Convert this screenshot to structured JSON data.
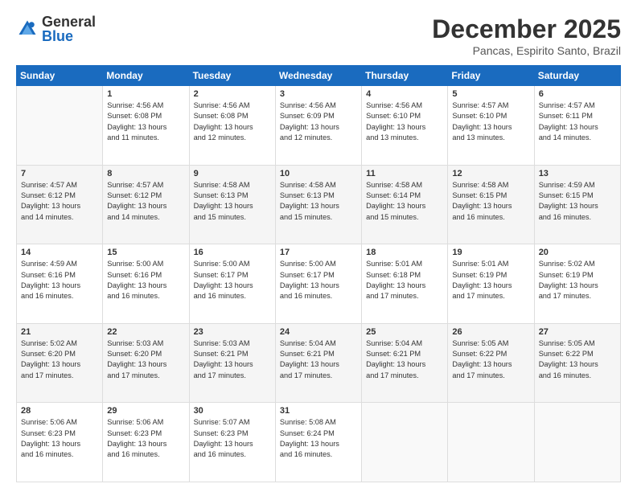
{
  "header": {
    "logo_general": "General",
    "logo_blue": "Blue",
    "month_title": "December 2025",
    "location": "Pancas, Espirito Santo, Brazil"
  },
  "weekdays": [
    "Sunday",
    "Monday",
    "Tuesday",
    "Wednesday",
    "Thursday",
    "Friday",
    "Saturday"
  ],
  "weeks": [
    [
      {
        "day": "",
        "info": ""
      },
      {
        "day": "1",
        "info": "Sunrise: 4:56 AM\nSunset: 6:08 PM\nDaylight: 13 hours\nand 11 minutes."
      },
      {
        "day": "2",
        "info": "Sunrise: 4:56 AM\nSunset: 6:08 PM\nDaylight: 13 hours\nand 12 minutes."
      },
      {
        "day": "3",
        "info": "Sunrise: 4:56 AM\nSunset: 6:09 PM\nDaylight: 13 hours\nand 12 minutes."
      },
      {
        "day": "4",
        "info": "Sunrise: 4:56 AM\nSunset: 6:10 PM\nDaylight: 13 hours\nand 13 minutes."
      },
      {
        "day": "5",
        "info": "Sunrise: 4:57 AM\nSunset: 6:10 PM\nDaylight: 13 hours\nand 13 minutes."
      },
      {
        "day": "6",
        "info": "Sunrise: 4:57 AM\nSunset: 6:11 PM\nDaylight: 13 hours\nand 14 minutes."
      }
    ],
    [
      {
        "day": "7",
        "info": "Sunrise: 4:57 AM\nSunset: 6:12 PM\nDaylight: 13 hours\nand 14 minutes."
      },
      {
        "day": "8",
        "info": "Sunrise: 4:57 AM\nSunset: 6:12 PM\nDaylight: 13 hours\nand 14 minutes."
      },
      {
        "day": "9",
        "info": "Sunrise: 4:58 AM\nSunset: 6:13 PM\nDaylight: 13 hours\nand 15 minutes."
      },
      {
        "day": "10",
        "info": "Sunrise: 4:58 AM\nSunset: 6:13 PM\nDaylight: 13 hours\nand 15 minutes."
      },
      {
        "day": "11",
        "info": "Sunrise: 4:58 AM\nSunset: 6:14 PM\nDaylight: 13 hours\nand 15 minutes."
      },
      {
        "day": "12",
        "info": "Sunrise: 4:58 AM\nSunset: 6:15 PM\nDaylight: 13 hours\nand 16 minutes."
      },
      {
        "day": "13",
        "info": "Sunrise: 4:59 AM\nSunset: 6:15 PM\nDaylight: 13 hours\nand 16 minutes."
      }
    ],
    [
      {
        "day": "14",
        "info": "Sunrise: 4:59 AM\nSunset: 6:16 PM\nDaylight: 13 hours\nand 16 minutes."
      },
      {
        "day": "15",
        "info": "Sunrise: 5:00 AM\nSunset: 6:16 PM\nDaylight: 13 hours\nand 16 minutes."
      },
      {
        "day": "16",
        "info": "Sunrise: 5:00 AM\nSunset: 6:17 PM\nDaylight: 13 hours\nand 16 minutes."
      },
      {
        "day": "17",
        "info": "Sunrise: 5:00 AM\nSunset: 6:17 PM\nDaylight: 13 hours\nand 16 minutes."
      },
      {
        "day": "18",
        "info": "Sunrise: 5:01 AM\nSunset: 6:18 PM\nDaylight: 13 hours\nand 17 minutes."
      },
      {
        "day": "19",
        "info": "Sunrise: 5:01 AM\nSunset: 6:19 PM\nDaylight: 13 hours\nand 17 minutes."
      },
      {
        "day": "20",
        "info": "Sunrise: 5:02 AM\nSunset: 6:19 PM\nDaylight: 13 hours\nand 17 minutes."
      }
    ],
    [
      {
        "day": "21",
        "info": "Sunrise: 5:02 AM\nSunset: 6:20 PM\nDaylight: 13 hours\nand 17 minutes."
      },
      {
        "day": "22",
        "info": "Sunrise: 5:03 AM\nSunset: 6:20 PM\nDaylight: 13 hours\nand 17 minutes."
      },
      {
        "day": "23",
        "info": "Sunrise: 5:03 AM\nSunset: 6:21 PM\nDaylight: 13 hours\nand 17 minutes."
      },
      {
        "day": "24",
        "info": "Sunrise: 5:04 AM\nSunset: 6:21 PM\nDaylight: 13 hours\nand 17 minutes."
      },
      {
        "day": "25",
        "info": "Sunrise: 5:04 AM\nSunset: 6:21 PM\nDaylight: 13 hours\nand 17 minutes."
      },
      {
        "day": "26",
        "info": "Sunrise: 5:05 AM\nSunset: 6:22 PM\nDaylight: 13 hours\nand 17 minutes."
      },
      {
        "day": "27",
        "info": "Sunrise: 5:05 AM\nSunset: 6:22 PM\nDaylight: 13 hours\nand 16 minutes."
      }
    ],
    [
      {
        "day": "28",
        "info": "Sunrise: 5:06 AM\nSunset: 6:23 PM\nDaylight: 13 hours\nand 16 minutes."
      },
      {
        "day": "29",
        "info": "Sunrise: 5:06 AM\nSunset: 6:23 PM\nDaylight: 13 hours\nand 16 minutes."
      },
      {
        "day": "30",
        "info": "Sunrise: 5:07 AM\nSunset: 6:23 PM\nDaylight: 13 hours\nand 16 minutes."
      },
      {
        "day": "31",
        "info": "Sunrise: 5:08 AM\nSunset: 6:24 PM\nDaylight: 13 hours\nand 16 minutes."
      },
      {
        "day": "",
        "info": ""
      },
      {
        "day": "",
        "info": ""
      },
      {
        "day": "",
        "info": ""
      }
    ]
  ]
}
